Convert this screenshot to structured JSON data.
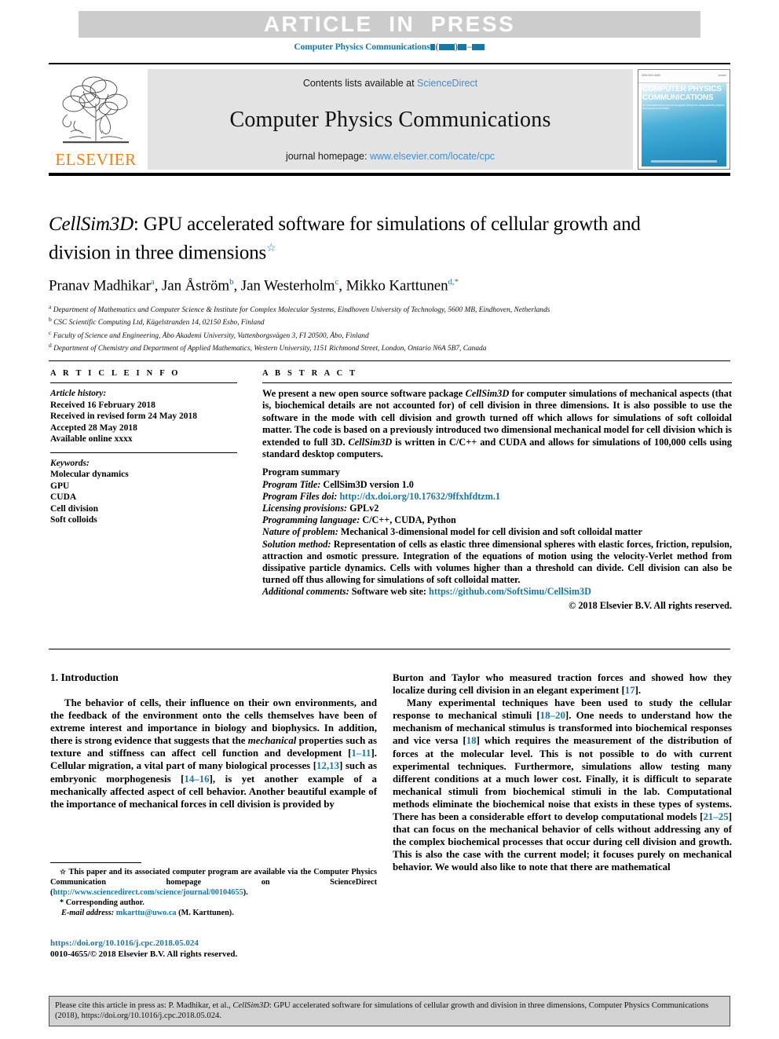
{
  "banner": {
    "text": "ARTICLE  IN  PRESS"
  },
  "running_head": {
    "journal": "Computer Physics Communications"
  },
  "masthead": {
    "contents_prefix": "Contents lists available at ",
    "sciencedirect": "ScienceDirect",
    "journal_title": "Computer Physics Communications",
    "homepage_prefix": "journal homepage: ",
    "homepage_url": "www.elsevier.com/locate/cpc",
    "publisher": "ELSEVIER",
    "cover": {
      "title": "COMPUTER PHYSICS COMMUNICATIONS",
      "subtitle": "An International journal and program library for computational physics and physical chemistry",
      "top_left": "ISSN 0010-4655",
      "top_right": "Volume"
    }
  },
  "article": {
    "title_part1": "CellSim3D",
    "title_part2": ": GPU accelerated software for simulations of cellular growth and division in three dimensions",
    "title_star": "☆",
    "authors": [
      {
        "name": "Pranav Madhikar",
        "sup": "a",
        "sep": ", "
      },
      {
        "name": "Jan Åström",
        "sup": "b",
        "sep": ", "
      },
      {
        "name": "Jan Westerholm",
        "sup": "c",
        "sep": ", "
      },
      {
        "name": "Mikko Karttunen",
        "sup": "d,*",
        "sep": ""
      }
    ],
    "affiliations": [
      {
        "mark": "a",
        "text": "Department of Mathematics and Computer Science & Institute for Complex Molecular Systems, Eindhoven University of Technology, 5600 MB, Eindhoven, Netherlands"
      },
      {
        "mark": "b",
        "text": "CSC Scientific Computing Ltd, Kägelstranden 14, 02150 Esbo, Finland"
      },
      {
        "mark": "c",
        "text": "Faculty of Science and Engineering, Åbo Akademi University, Vattenborgsvägen 3, FI 20500, Åbo, Finland"
      },
      {
        "mark": "d",
        "text": "Department of Chemistry and Department of Applied Mathematics, Western University, 1151 Richmond Street, London, Ontario N6A 5B7, Canada"
      }
    ]
  },
  "article_info": {
    "heading": "A R T I C L E  I N F O",
    "history_label": "Article history:",
    "history": [
      "Received 16 February 2018",
      "Received in revised form 24 May 2018",
      "Accepted 28 May 2018",
      "Available online xxxx"
    ],
    "keywords_label": "Keywords:",
    "keywords": [
      "Molecular dynamics",
      "GPU",
      "CUDA",
      "Cell division",
      "Soft colloids"
    ]
  },
  "abstract": {
    "heading": "A B S T R A C T",
    "text_a": "We present a new open source software package ",
    "italic_a": "CellSim3D",
    "text_b": " for computer simulations of mechanical aspects (that is, biochemical details are not accounted for) of cell division in three dimensions. It is also possible to use the software in the mode with cell division and growth turned off which allows for simulations of soft colloidal matter. The code is based on a previously introduced two dimensional mechanical model for cell division which is extended to full 3D. ",
    "italic_b": "CellSim3D",
    "text_c": " is written in C/C++ and CUDA and allows for simulations of 100,000 cells using standard desktop computers."
  },
  "program_summary": {
    "heading": "Program summary",
    "items": [
      {
        "label": "Program Title:",
        "value": " CellSim3D version 1.0",
        "link": ""
      },
      {
        "label": "Program Files doi:",
        "value": " ",
        "link": "http://dx.doi.org/10.17632/9ffxhfdtzm.1"
      },
      {
        "label": "Licensing provisions:",
        "value": " GPLv2",
        "link": ""
      },
      {
        "label": "Programming language:",
        "value": " C/C++, CUDA, Python",
        "link": ""
      },
      {
        "label": "Nature of problem:",
        "value": " Mechanical 3-dimensional model for cell division and soft colloidal matter",
        "link": ""
      },
      {
        "label": "Solution method:",
        "value": " Representation of cells as elastic three dimensional spheres with elastic forces, friction, repulsion, attraction and osmotic pressure. Integration of the equations of motion using the velocity-Verlet method from dissipative particle dynamics. Cells with volumes higher than a threshold can divide. Cell division can also be turned off thus allowing for simulations of soft colloidal matter.",
        "link": ""
      },
      {
        "label": "Additional comments:",
        "value": " Software web site: ",
        "link": "https://github.com/SoftSimu/CellSim3D"
      }
    ],
    "copyright": "© 2018 Elsevier B.V. All rights reserved."
  },
  "body": {
    "section_number_title": "1. Introduction",
    "left_paragraph_a": "The behavior of cells, their influence on their own environments, and the feedback of the environment onto the cells themselves have been of extreme interest and importance in biology and biophysics. In addition, there is strong evidence that suggests that the ",
    "left_paragraph_a_italic": "mechanical",
    "left_paragraph_a2": " properties such as texture and stiffness can affect cell function and development [",
    "ref_1_11": "1–11",
    "left_paragraph_a3": "]. Cellular migration, a vital part of many biological processes [",
    "ref_12_13": "12,13",
    "left_paragraph_a4": "] such as embryonic morphogenesis [",
    "ref_14_16": "14–16",
    "left_paragraph_a5": "], is yet another example of a mechanically affected aspect of cell behavior. Another beautiful example of the importance of mechanical forces in cell division is provided by",
    "right_paragraph_a": "Burton and Taylor who measured traction forces and showed how they localize during cell division in an elegant experiment [",
    "ref_17": "17",
    "right_paragraph_a2": "].",
    "right_paragraph_b": "Many experimental techniques have been used to study the cellular response to mechanical stimuli [",
    "ref_18_20": "18–20",
    "right_paragraph_b2": "]. One needs to understand how the mechanism of mechanical stimulus is transformed into biochemical responses and vice versa [",
    "ref_18": "18",
    "right_paragraph_b3": "] which requires the measurement of the distribution of forces at the molecular level. This is not possible to do with current experimental techniques. Furthermore, simulations allow testing many different conditions at a much lower cost. Finally, it is difficult to separate mechanical stimuli from biochemical stimuli in the lab. Computational methods eliminate the biochemical noise that exists in these types of systems. There has been a considerable effort to develop computational models [",
    "ref_21_25": "21–25",
    "right_paragraph_b4": "] that can focus on the mechanical behavior of cells without addressing any of the complex biochemical processes that occur during cell division and growth. This is also the case with the current model; it focuses purely on mechanical behavior. We would also like to note that there are mathematical"
  },
  "footnotes": {
    "star": "☆",
    "star_text_a": " This paper and its associated computer program are available via the Computer Physics Communication homepage on ScienceDirect (",
    "star_link": "http://www.sciencedirect.com/science/journal/00104655",
    "star_text_b": ").",
    "corresponding_mark": "*",
    "corresponding_text": " Corresponding author.",
    "email_label": "E-mail address:",
    "email_link": " mkarttu@uwo.ca",
    "email_suffix": " (M. Karttunen)."
  },
  "doi_block": {
    "doi_link": "https://doi.org/10.1016/j.cpc.2018.05.024",
    "issn_line": "0010-4655/© 2018 Elsevier B.V. All rights reserved."
  },
  "citation_footer": {
    "prefix": "Please cite this article in press as: P. Madhikar, et al., ",
    "italic": "CellSim3D",
    "suffix": ": GPU accelerated software for simulations of cellular growth and division in three dimensions, Computer Physics Communications (2018), https://doi.org/10.1016/j.cpc.2018.05.024."
  },
  "colors": {
    "link": "#1578a5",
    "banner_bg": "#cccccc",
    "masthead_bg": "#e3e3e3",
    "elsevier_orange": "#f08010",
    "cite_bg": "#d2d2d2"
  }
}
